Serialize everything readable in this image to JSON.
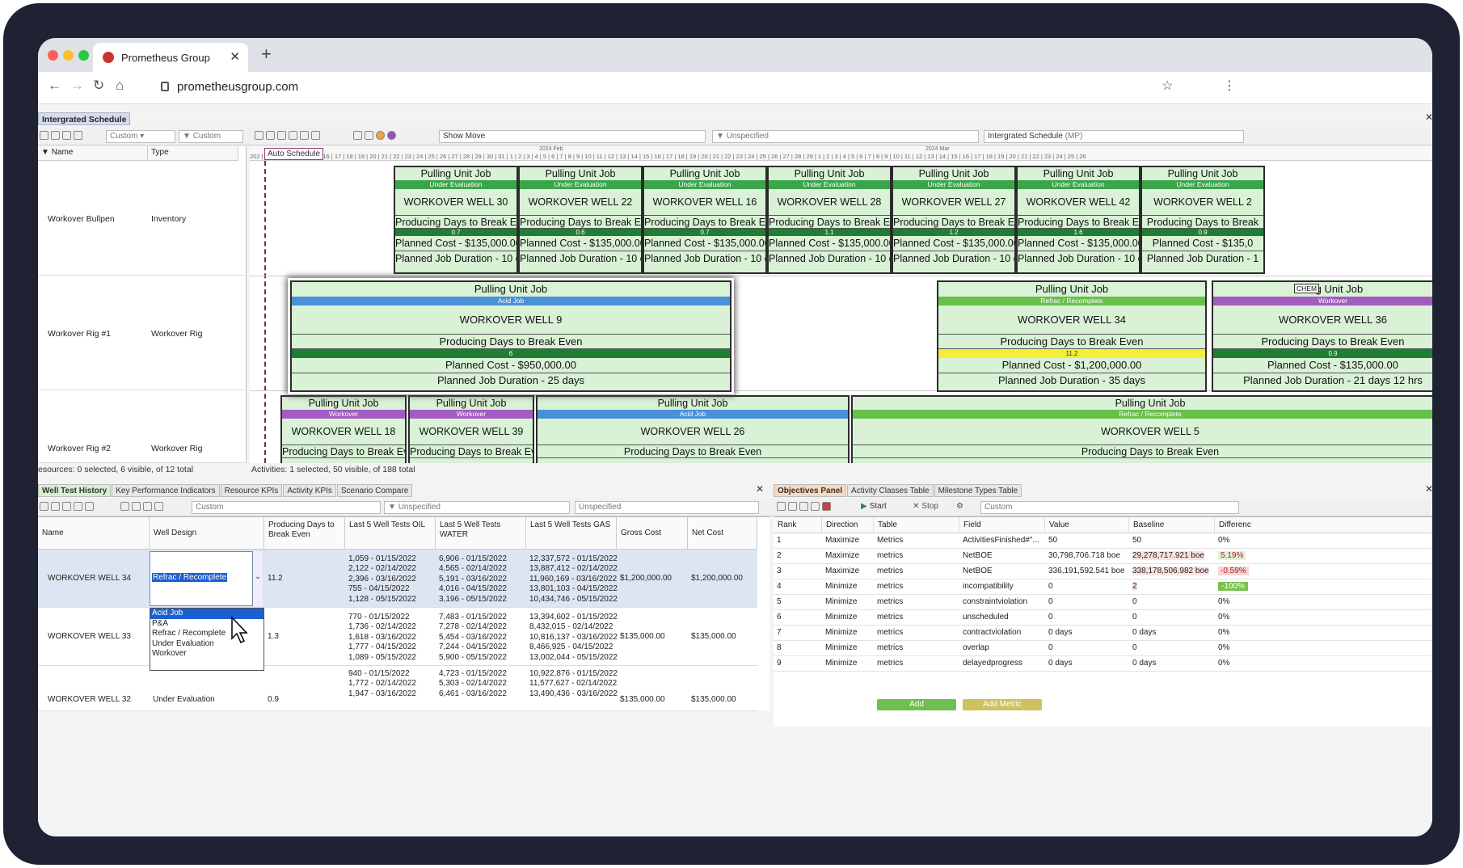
{
  "browser": {
    "tab_title": "Prometheus Group",
    "url": "prometheusgroup.com"
  },
  "app": {
    "doc_tab": "Intergrated Schedule",
    "toolbar": {
      "custom1": "Custom",
      "custom2": "Custom",
      "show_move": "Show Move",
      "unspecified": "Unspecified",
      "schedule": "Intergrated Schedule",
      "schedule_suffix": "(MP)"
    },
    "columns": {
      "name": "Name",
      "type": "Type"
    },
    "resources": [
      {
        "name": "Workover Bullpen",
        "type": "Inventory"
      },
      {
        "name": "Workover Rig #1",
        "type": "Workover Rig"
      },
      {
        "name": "Workover Rig #2",
        "type": "Workover Rig"
      }
    ],
    "ruler": {
      "auto_schedule": "Auto Schedule",
      "ticks": "202 | 11 | 12 | 13 | 14 | 15 | 16 | 17 | 18 | 19 | 20 | 21 | 22 | 23 | 24 | 25 | 26 | 27 | 28 | 29 | 30 | 31 | 1 | 2 | 3 | 4 | 5 | 6 | 7 | 8 | 9 | 10 | 11 | 12 | 13 | 14 | 15 | 16 | 17 | 18 | 19 | 20 | 21 | 22 | 23 | 24 | 25 | 26 | 27 | 28 | 29 | 1 | 2 | 3 | 4 | 5 | 6 | 7 | 8 | 9 | 10 | 11 | 12 | 13 | 14 | 15 | 16 | 17 | 18 | 19 | 20 | 21 | 22 | 23 | 24 | 25 | 26",
      "month_feb": "2024 Feb",
      "month_mar": "2024 Mar"
    },
    "bullpen_cards": [
      {
        "title": "Pulling Unit Job",
        "status": "Under Evaluation",
        "well": "WORKOVER WELL 30",
        "metric": "Producing Days to Break Even",
        "value": "0.7",
        "cost": "Planned Cost - $135,000.00",
        "duration": "Planned Job Duration - 10 days"
      },
      {
        "title": "Pulling Unit Job",
        "status": "Under Evaluation",
        "well": "WORKOVER WELL 22",
        "metric": "Producing Days to Break Even",
        "value": "0.6",
        "cost": "Planned Cost - $135,000.00",
        "duration": "Planned Job Duration - 10 days"
      },
      {
        "title": "Pulling Unit Job",
        "status": "Under Evaluation",
        "well": "WORKOVER WELL 16",
        "metric": "Producing Days to Break Even",
        "value": "0.7",
        "cost": "Planned Cost - $135,000.00",
        "duration": "Planned Job Duration - 10 days"
      },
      {
        "title": "Pulling Unit Job",
        "status": "Under Evaluation",
        "well": "WORKOVER WELL 28",
        "metric": "Producing Days to Break Even",
        "value": "1.1",
        "cost": "Planned Cost - $135,000.00",
        "duration": "Planned Job Duration - 10 days"
      },
      {
        "title": "Pulling Unit Job",
        "status": "Under Evaluation",
        "well": "WORKOVER WELL 27",
        "metric": "Producing Days to Break Even",
        "value": "1.2",
        "cost": "Planned Cost - $135,000.00",
        "duration": "Planned Job Duration - 10 days"
      },
      {
        "title": "Pulling Unit Job",
        "status": "Under Evaluation",
        "well": "WORKOVER WELL 42",
        "metric": "Producing Days to Break Even",
        "value": "1.6",
        "cost": "Planned Cost - $135,000.00",
        "duration": "Planned Job Duration - 10 days"
      },
      {
        "title": "Pulling Unit Job",
        "status": "Under Evaluation",
        "well": "WORKOVER WELL 2",
        "metric": "Producing Days to Break",
        "value": "0.9",
        "cost": "Planned Cost - $135,0",
        "duration": "Planned Job Duration - 1"
      }
    ],
    "rig1_cards": [
      {
        "title": "Pulling Unit Job",
        "status": "Refrac / Recomplete",
        "well": "WORKOVER WELL 34",
        "metric": "Producing Days to Break Even",
        "value": "11.2",
        "cost": "Planned Cost - $1,200,000.00",
        "duration": "Planned Job Duration - 35 days"
      },
      {
        "title": "lling Unit Job",
        "status": "Workover",
        "well": "WORKOVER WELL 36",
        "metric": "Producing Days to Break Even",
        "value": "0.9",
        "cost": "Planned Cost - $135,000.00",
        "duration": "Planned Job Duration - 21 days 12 hrs",
        "tag": "CHEM"
      },
      {
        "title": "Pulling Unit Job",
        "status": "Acid Job",
        "well": "WORKOVER WELL 9",
        "metric": "Producing Days to Break Even",
        "value": "6",
        "cost": "Planned Cost - $950,000.00",
        "duration": "Planned Job Duration - 25 days"
      }
    ],
    "rig2_cards": [
      {
        "title": "Pulling Unit Job",
        "status": "Workover",
        "well": "WORKOVER WELL 18",
        "metric": "Producing Days to Break Even"
      },
      {
        "title": "Pulling Unit Job",
        "status": "Workover",
        "well": "WORKOVER WELL 39",
        "metric": "Producing Days to Break Even"
      },
      {
        "title": "Pulling Unit Job",
        "status": "Acid Job",
        "well": "WORKOVER WELL 26",
        "metric": "Producing Days to Break Even"
      },
      {
        "title": "Pulling Unit Job",
        "status": "Refrac / Recomplete",
        "well": "WORKOVER WELL 5",
        "metric": "Producing Days to Break Even"
      }
    ],
    "status_left": "esources: 0 selected, 6 visible, of 12 total",
    "status_right": "Activities: 1 selected, 50 visible, of 188 total"
  },
  "bottom_left": {
    "tabs": [
      "Well Test History",
      "Key Performance Indicators",
      "Resource KPIs",
      "Activity KPIs",
      "Scenario Compare"
    ],
    "toolbar": {
      "custom": "Custom",
      "unspecified1": "Unspecified",
      "unspecified2": "Unspecified"
    },
    "headers": [
      "Name",
      "Well Design",
      "Producing Days to Break Even",
      "Last 5 Well Tests OIL",
      "Last 5 Well Tests WATER",
      "Last 5 Well Tests GAS",
      "Gross Cost",
      "Net Cost"
    ],
    "rows": [
      {
        "name": "WORKOVER WELL 34",
        "design": "Refrac / Recomplete",
        "days": "11.2",
        "oil": [
          "1,059 - 01/15/2022",
          "2,122 - 02/14/2022",
          "2,396 - 03/16/2022",
          "755 - 04/15/2022",
          "1,128 - 05/15/2022"
        ],
        "water": [
          "6,906 - 01/15/2022",
          "4,565 - 02/14/2022",
          "5,191 - 03/16/2022",
          "4,016 - 04/15/2022",
          "3,196 - 05/15/2022"
        ],
        "gas": [
          "12,337,572 - 01/15/2022",
          "13,887,412 - 02/14/2022",
          "11,960,169 - 03/16/2022",
          "13,801,103 - 04/15/2022",
          "10,434,746 - 05/15/2022"
        ],
        "gross": "$1,200,000.00",
        "net": "$1,200,000.00"
      },
      {
        "name": "WORKOVER WELL 33",
        "design": "",
        "days": "1.3",
        "oil": [
          "770 - 01/15/2022",
          "1,736 - 02/14/2022",
          "1,618 - 03/16/2022",
          "1,777 - 04/15/2022",
          "1,089 - 05/15/2022"
        ],
        "water": [
          "7,483 - 01/15/2022",
          "7,278 - 02/14/2022",
          "5,454 - 03/16/2022",
          "7,244 - 04/15/2022",
          "5,900 - 05/15/2022"
        ],
        "gas": [
          "13,394,602 - 01/15/2022",
          "8,432,015 - 02/14/2022",
          "10,816,137 - 03/16/2022",
          "8,466,925 - 04/15/2022",
          "13,002,044 - 05/15/2022"
        ],
        "gross": "$135,000.00",
        "net": "$135,000.00"
      },
      {
        "name": "WORKOVER WELL 32",
        "design": "Under Evaluation",
        "days": "0.9",
        "oil": [
          "940 - 01/15/2022",
          "1,772 - 02/14/2022",
          "1,947 - 03/16/2022"
        ],
        "water": [
          "4,723 - 01/15/2022",
          "5,303 - 02/14/2022",
          "6,461 - 03/16/2022"
        ],
        "gas": [
          "10,922,876 - 01/15/2022",
          "11,577,627 - 02/14/2022",
          "13,490,436 - 03/16/2022"
        ],
        "gross": "$135,000.00",
        "net": "$135,000.00"
      }
    ],
    "dropdown_options": [
      "Acid Job",
      "P&A",
      "Refrac / Recomplete",
      "Under Evaluation",
      "Workover"
    ],
    "dropdown_highlight": "Acid Job"
  },
  "bottom_right": {
    "tabs": [
      "Objectives Panel",
      "Activity Classes Table",
      "Milestone Types Table"
    ],
    "toolbar": {
      "start": "Start",
      "stop": "Stop",
      "custom": "Custom"
    },
    "headers": [
      "Rank",
      "Direction",
      "Table",
      "Field",
      "Value",
      "Baseline",
      "Differenc"
    ],
    "rows": [
      {
        "rank": "1",
        "dir": "Maximize",
        "table": "Metrics",
        "field": "ActivitiesFinished#\"...",
        "value": "50",
        "baseline": "50",
        "diff": "0%"
      },
      {
        "rank": "2",
        "dir": "Maximize",
        "table": "metrics",
        "field": "NetBOE",
        "value": "30,798,706.718 boe",
        "baseline": "29,278,717.921 boe",
        "diff": "5.19%"
      },
      {
        "rank": "3",
        "dir": "Maximize",
        "table": "metrics",
        "field": "NetBOE",
        "value": "336,191,592.541 boe",
        "baseline": "338,178,506.982 boe",
        "diff": "-0.59%"
      },
      {
        "rank": "4",
        "dir": "Minimize",
        "table": "metrics",
        "field": "incompatibility",
        "value": "0",
        "baseline": "2",
        "diff": "-100%"
      },
      {
        "rank": "5",
        "dir": "Minimize",
        "table": "metrics",
        "field": "constraintviolation",
        "value": "0",
        "baseline": "0",
        "diff": "0%"
      },
      {
        "rank": "6",
        "dir": "Minimize",
        "table": "metrics",
        "field": "unscheduled",
        "value": "0",
        "baseline": "0",
        "diff": "0%"
      },
      {
        "rank": "7",
        "dir": "Minimize",
        "table": "metrics",
        "field": "contractviolation",
        "value": "0 days",
        "baseline": "0 days",
        "diff": "0%"
      },
      {
        "rank": "8",
        "dir": "Minimize",
        "table": "metrics",
        "field": "overlap",
        "value": "0",
        "baseline": "0",
        "diff": "0%"
      },
      {
        "rank": "9",
        "dir": "Minimize",
        "table": "metrics",
        "field": "delayedprogress",
        "value": "0 days",
        "baseline": "0 days",
        "diff": "0%"
      }
    ],
    "add_label": "Add",
    "add_metric_label": "Add Metric"
  },
  "colors": {
    "under_evaluation": "#3aa54a",
    "refrac": "#66c04a",
    "workover": "#a45bc2",
    "acid": "#4a90d9",
    "value_green": "#1e7f33",
    "value_yellow": "#f5ec3b"
  }
}
